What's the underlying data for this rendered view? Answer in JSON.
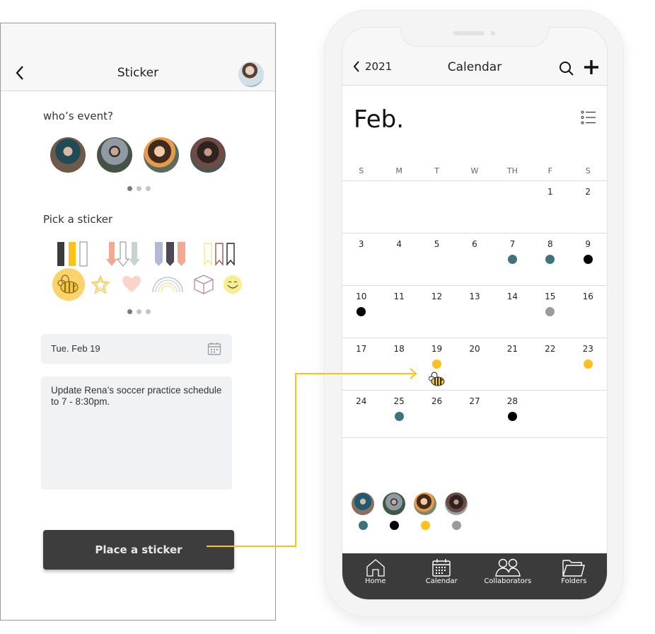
{
  "left_panel": {
    "header": {
      "title": "Sticker",
      "back_icon": "chevron-left-icon",
      "avatar": "user-avatar"
    },
    "who_section": {
      "label": "who’s event?",
      "people": [
        {
          "name": "person-1",
          "colors": [
            "#2f4c55",
            "#8a6f5c"
          ]
        },
        {
          "name": "person-2",
          "colors": [
            "#4c5a50",
            "#9aa4ad"
          ]
        },
        {
          "name": "person-3",
          "colors": [
            "#e6a46a",
            "#4a3a2e"
          ]
        },
        {
          "name": "person-4",
          "colors": [
            "#3b3532",
            "#7a5a52"
          ]
        }
      ],
      "pager": {
        "count": 3,
        "active": 0
      }
    },
    "sticker_section": {
      "label": "Pick a sticker",
      "row1": [
        "flag-set-dark-yellow-white",
        "arrow-set-coral-white-sage",
        "tab-set-lavender-dark-peach",
        "ribbon-set-yellow-mauve-black"
      ],
      "row2": [
        "bee",
        "star",
        "heart",
        "rainbow",
        "cube",
        "smiley"
      ],
      "selected": "bee",
      "pager": {
        "count": 3,
        "active": 0
      }
    },
    "date_field": {
      "value": "Tue. Feb 19",
      "icon": "calendar-icon"
    },
    "notes_field": {
      "value": "Update Rena’s soccer practice schedule to 7 - 8:30pm."
    },
    "place_button": {
      "label": "Place a sticker"
    }
  },
  "colors": {
    "accent_yellow": "#fdc21a",
    "teal": "#3e737c",
    "black": "#000000",
    "gray": "#9b9b9b",
    "tabbar": "#3b3b3b",
    "button": "#3d3d3d"
  },
  "calendar": {
    "header": {
      "back_label": "2021",
      "title": "Calendar",
      "search_icon": "search-icon",
      "add_icon": "plus-icon"
    },
    "month": "Feb.",
    "weekdays": [
      "S",
      "M",
      "T",
      "W",
      "TH",
      "F",
      "S"
    ],
    "weeks": [
      [
        null,
        null,
        null,
        null,
        null,
        {
          "d": "1"
        },
        {
          "d": "2"
        }
      ],
      [
        {
          "d": "3"
        },
        {
          "d": "4"
        },
        {
          "d": "5"
        },
        {
          "d": "6"
        },
        {
          "d": "7",
          "dot": "teal"
        },
        {
          "d": "8",
          "dot": "teal"
        },
        {
          "d": "9",
          "dot": "black"
        }
      ],
      [
        {
          "d": "10",
          "dot": "black"
        },
        {
          "d": "11"
        },
        {
          "d": "12"
        },
        {
          "d": "13"
        },
        {
          "d": "14"
        },
        {
          "d": "15",
          "dot": "gray"
        },
        {
          "d": "16"
        }
      ],
      [
        {
          "d": "17"
        },
        {
          "d": "18"
        },
        {
          "d": "19",
          "dot": "accent_yellow",
          "sticker": "bee"
        },
        {
          "d": "20"
        },
        {
          "d": "21"
        },
        {
          "d": "22"
        },
        {
          "d": "23",
          "dot": "accent_yellow"
        }
      ],
      [
        {
          "d": "24"
        },
        {
          "d": "25",
          "dot": "teal"
        },
        {
          "d": "26"
        },
        {
          "d": "27"
        },
        {
          "d": "28",
          "dot": "black"
        },
        null,
        null
      ]
    ],
    "collaborators": [
      {
        "name": "collaborator-1",
        "dot": "teal"
      },
      {
        "name": "collaborator-2",
        "dot": "black"
      },
      {
        "name": "collaborator-3",
        "dot": "accent_yellow"
      },
      {
        "name": "collaborator-4",
        "dot": "gray"
      }
    ],
    "tabbar": [
      {
        "label": "Home",
        "icon": "home-icon"
      },
      {
        "label": "Calendar",
        "icon": "calendar-icon"
      },
      {
        "label": "Collaborators",
        "icon": "people-icon"
      },
      {
        "label": "Folders",
        "icon": "folder-icon"
      }
    ]
  }
}
